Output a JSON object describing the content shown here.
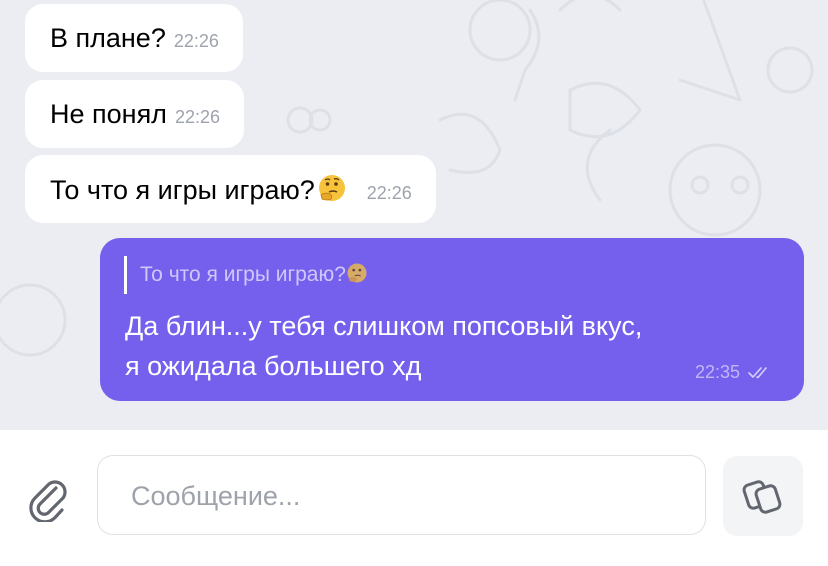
{
  "messages": [
    {
      "text": "В плане?",
      "time": "22:26",
      "direction": "incoming"
    },
    {
      "text": "Не понял",
      "time": "22:26",
      "direction": "incoming"
    },
    {
      "text": "То что я игры играю?",
      "emoji": "thinking-face",
      "time": "22:26",
      "direction": "incoming"
    }
  ],
  "reply": {
    "quote": "То что я игры играю?",
    "quote_emoji": "thinking-face",
    "line1": "Да блин...у тебя слишком попсовый вкус,",
    "line2": "я ожидала большего хд",
    "time": "22:35",
    "status": "read-double-check",
    "bubble_color": "#7460ed"
  },
  "composer": {
    "placeholder": "Сообщение...",
    "attach_icon": "paperclip-icon",
    "sticker_icon": "sticker-icon"
  },
  "colors": {
    "background": "#ebedf2",
    "incoming_bubble": "#ffffff",
    "timestamp": "#9ea3ad"
  }
}
